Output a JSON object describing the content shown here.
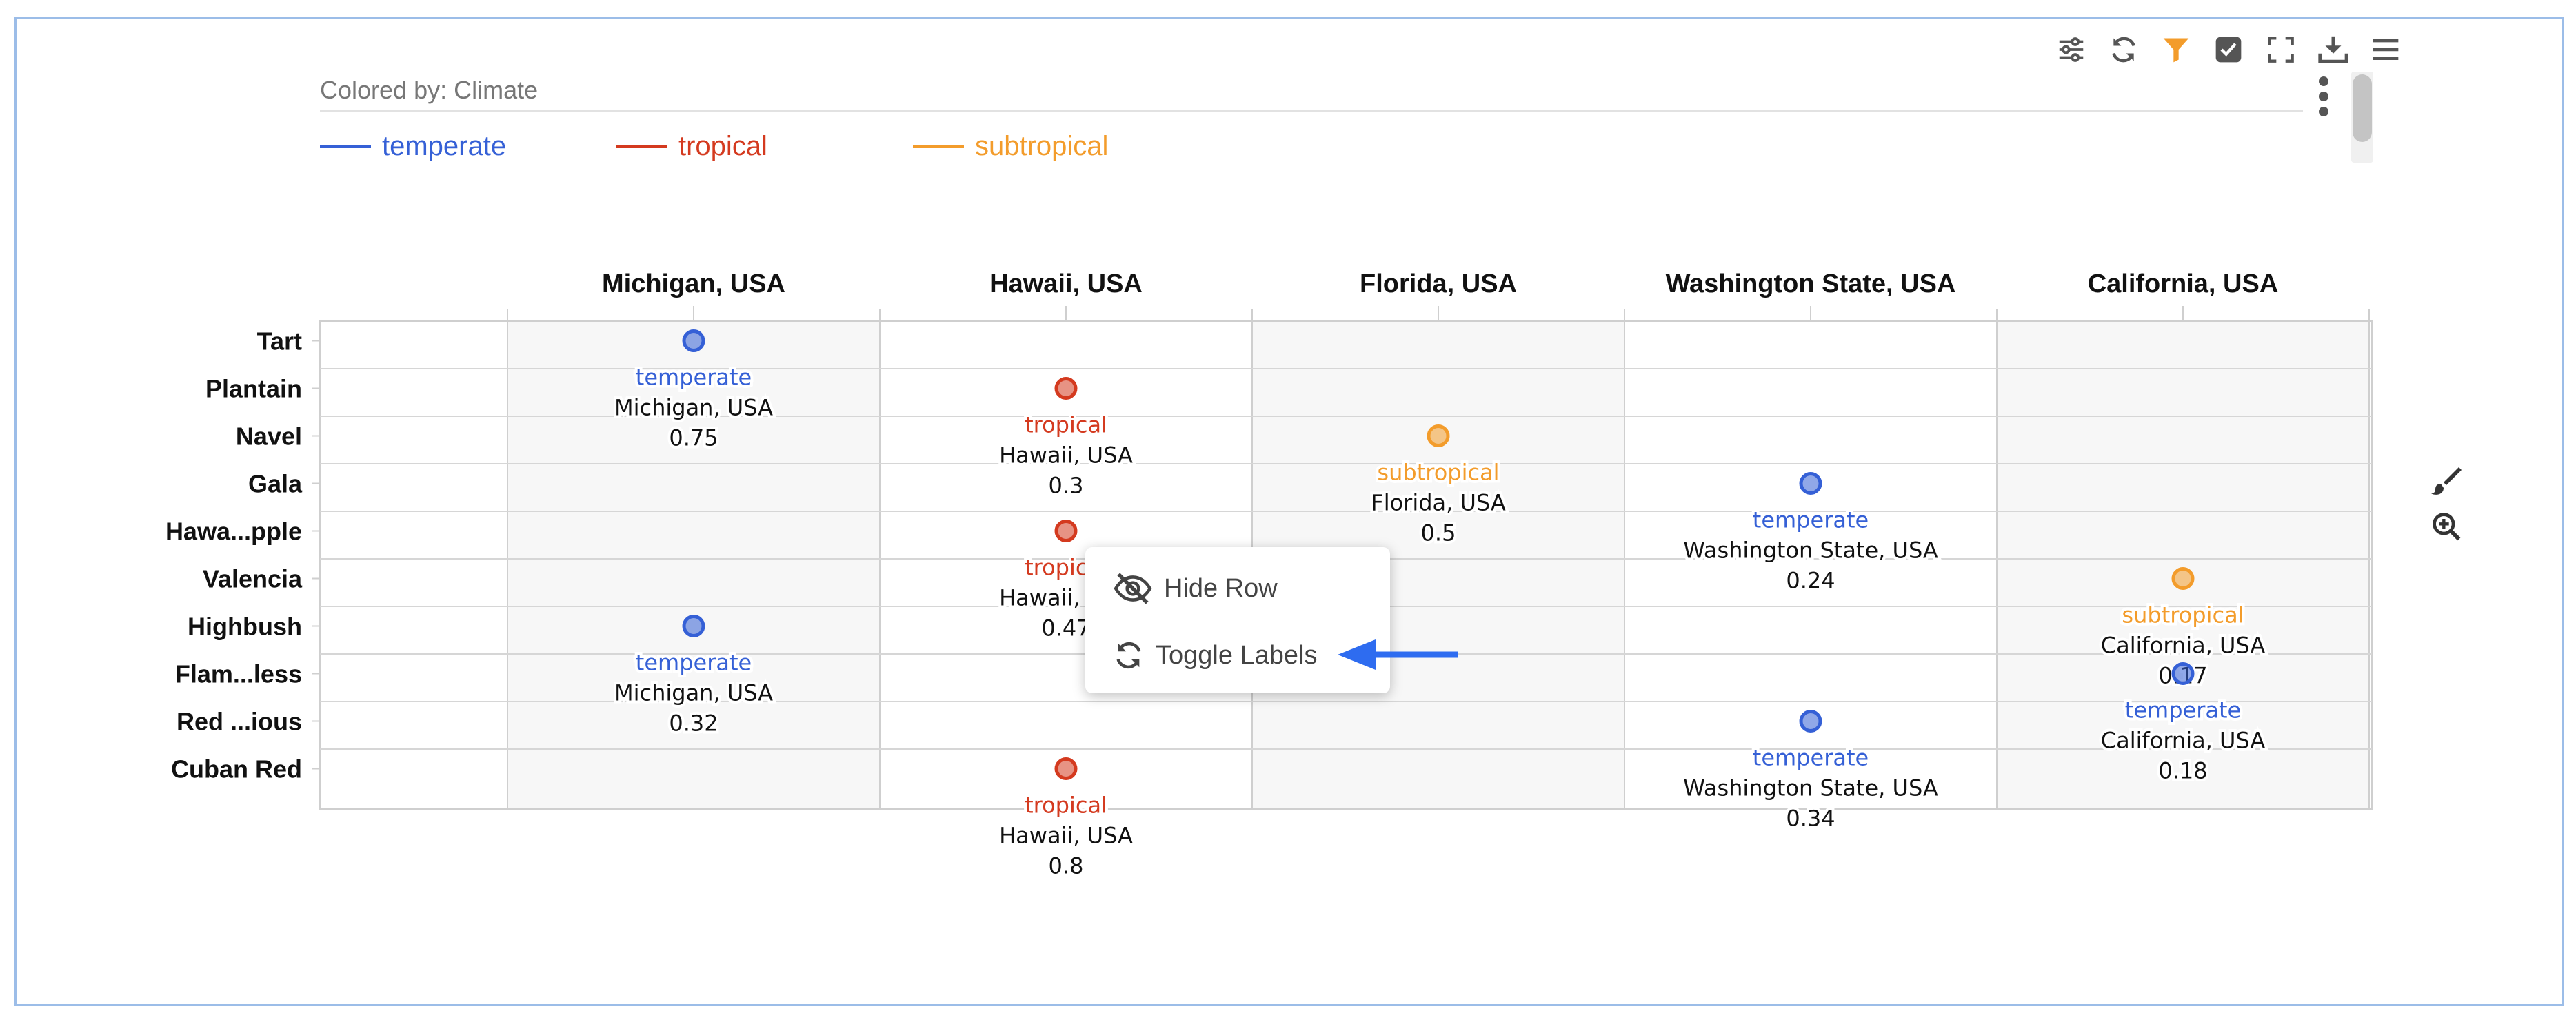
{
  "toolbar": {
    "icons": [
      "sliders-icon",
      "refresh-icon",
      "filter-icon",
      "checkbox-icon",
      "fullscreen-icon",
      "download-icon",
      "menu-icon"
    ],
    "filter_color": "#f39c2b"
  },
  "colored_by": "Colored by: Climate",
  "legend": [
    {
      "label": "temperate",
      "color": "#3560d6"
    },
    {
      "label": "tropical",
      "color": "#d43a1f"
    },
    {
      "label": "subtropical",
      "color": "#f39c2b"
    }
  ],
  "context_menu": {
    "items": [
      {
        "label": "Hide Row",
        "icon": "eye-slash-icon"
      },
      {
        "label": "Toggle Labels",
        "icon": "refresh-icon"
      }
    ]
  },
  "side_tools": [
    "brush-icon",
    "zoom-in-icon"
  ],
  "chart_data": {
    "type": "scatter",
    "columns": [
      "Michigan, USA",
      "Hawaii, USA",
      "Florida, USA",
      "Washington State, USA",
      "California, USA"
    ],
    "rows": [
      "Tart",
      "Plantain",
      "Navel",
      "Gala",
      "Hawa...pple",
      "Valencia",
      "Highbush",
      "Flam...less",
      "Red ...ious",
      "Cuban Red"
    ],
    "climate_colors": {
      "temperate": "#3560d6",
      "tropical": "#d43a1f",
      "subtropical": "#f39c2b"
    },
    "points": [
      {
        "row": "Tart",
        "col": "Michigan, USA",
        "climate": "temperate",
        "value": 0.75
      },
      {
        "row": "Plantain",
        "col": "Hawaii, USA",
        "climate": "tropical",
        "value": 0.3
      },
      {
        "row": "Navel",
        "col": "Florida, USA",
        "climate": "subtropical",
        "value": 0.5
      },
      {
        "row": "Gala",
        "col": "Washington State, USA",
        "climate": "temperate",
        "value": 0.24
      },
      {
        "row": "Hawa...pple",
        "col": "Hawaii, USA",
        "climate": "tropical",
        "value": 0.47
      },
      {
        "row": "Valencia",
        "col": "California, USA",
        "climate": "subtropical",
        "value": 0.17
      },
      {
        "row": "Highbush",
        "col": "Michigan, USA",
        "climate": "temperate",
        "value": 0.32
      },
      {
        "row": "Flam...less",
        "col": "California, USA",
        "climate": "temperate",
        "value": 0.18
      },
      {
        "row": "Red ...ious",
        "col": "Washington State, USA",
        "climate": "temperate",
        "value": 0.34
      },
      {
        "row": "Cuban Red",
        "col": "Hawaii, USA",
        "climate": "tropical",
        "value": 0.8
      }
    ]
  }
}
